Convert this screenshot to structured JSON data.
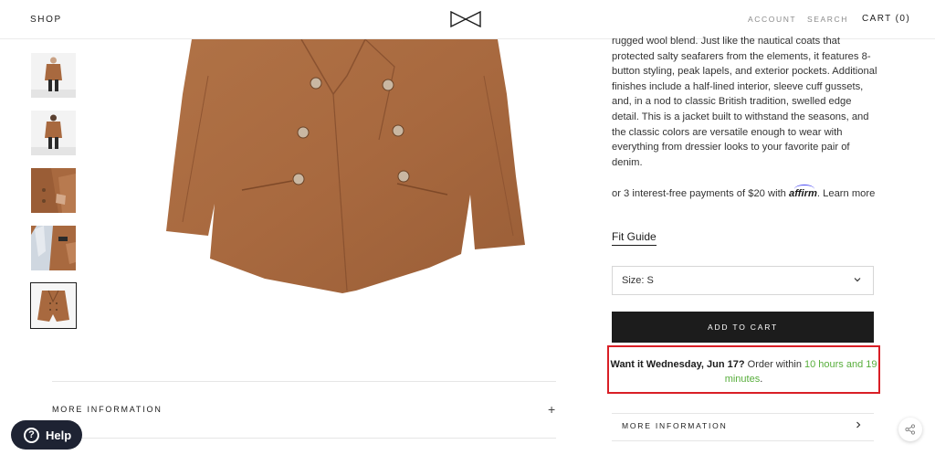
{
  "header": {
    "shop_label": "SHOP",
    "account_label": "ACCOUNT",
    "search_label": "SEARCH",
    "cart_label": "CART (0)"
  },
  "gallery": {
    "thumbnails": [
      "model-front-view",
      "model-back-view",
      "model-detail-view",
      "lining-detail-view",
      "flat-lay-view"
    ],
    "selected_index": 4
  },
  "product": {
    "description": "rugged wool blend. Just like the nautical coats that protected salty seafarers from the elements, it features 8-button styling, peak lapels, and exterior pockets. Additional finishes include a half-lined interior, sleeve cuff gussets, and, in a nod to classic British tradition, swelled edge detail. This is a jacket built to withstand the seasons, and the classic colors are versatile enough to wear with everything from dressier looks to your favorite pair of denim.",
    "affirm_prefix": "or 3 interest-free payments of $20 with",
    "affirm_logo": "affirm",
    "affirm_suffix": ". Learn more",
    "fit_guide_label": "Fit Guide",
    "size_select_value": "Size: S",
    "add_to_cart_label": "ADD TO CART",
    "delivery_bold": "Want it Wednesday, Jun 17?",
    "delivery_text": " Order within ",
    "delivery_time": "10 hours and 19 minutes",
    "delivery_end": "."
  },
  "left_accordion": {
    "more_info_label": "MORE INFORMATION",
    "toggle": "+"
  },
  "right_accordion": {
    "more_info_label": "MORE INFORMATION"
  },
  "help": {
    "label": "Help",
    "icon_glyph": "?"
  },
  "colors": {
    "coat": "#a8693f",
    "accent_green": "#58ae3c",
    "highlight_red": "#d91f26",
    "button_dark": "#1c1c1c",
    "help_bg": "#1e2333"
  }
}
